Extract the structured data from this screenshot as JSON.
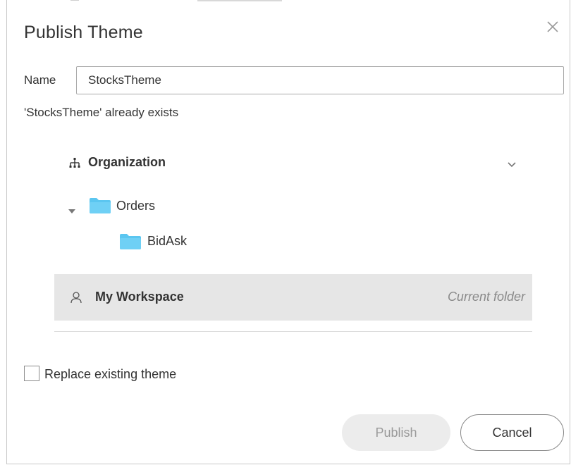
{
  "dialog": {
    "title": "Publish Theme",
    "close_icon": "close-icon"
  },
  "name_field": {
    "label": "Name",
    "value": "StocksTheme"
  },
  "validation_message": "'StocksTheme' already exists",
  "tree": {
    "organization": {
      "icon": "org-chart-icon",
      "label": "Organization",
      "toggle_icon": "chevron-down-icon"
    },
    "folders": [
      {
        "label": "Orders",
        "expanded": true,
        "icon": "folder-icon"
      },
      {
        "label": "BidAsk",
        "icon": "folder-icon"
      }
    ],
    "workspace": {
      "icon": "user-icon",
      "label": "My Workspace",
      "badge": "Current folder"
    }
  },
  "replace_option": {
    "label": "Replace existing theme",
    "checked": false
  },
  "buttons": {
    "publish": "Publish",
    "cancel": "Cancel"
  },
  "colors": {
    "folder": "#5bc6f0",
    "selected_row": "#e6e6e6",
    "disabled_button": "#ececec"
  }
}
